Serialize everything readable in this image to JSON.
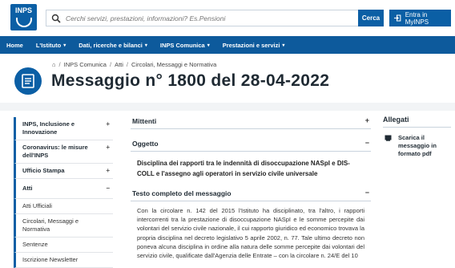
{
  "header": {
    "logo_text": "INPS",
    "search_placeholder": "Cerchi servizi, prestazioni, informazioni? Es.Pensioni",
    "search_button": "Cerca",
    "login_label": "Entra in MyINPS"
  },
  "nav": [
    "Home",
    "L'Istituto",
    "Dati, ricerche e bilanci",
    "INPS Comunica",
    "Prestazioni e servizi"
  ],
  "breadcrumb": [
    "INPS Comunica",
    "Atti",
    "Circolari, Messaggi e Normativa"
  ],
  "page_title": "Messaggio n° 1800 del 28-04-2022",
  "sidebar": {
    "items": [
      {
        "label": "INPS, Inclusione e Innovazione"
      },
      {
        "label": "Coronavirus: le misure dell'INPS"
      },
      {
        "label": "Ufficio Stampa"
      },
      {
        "label": "Atti"
      }
    ],
    "subitems": [
      "Atti Ufficiali",
      "Circolari, Messaggi e Normativa",
      "Sentenze",
      "Iscrizione Newsletter"
    ]
  },
  "sections": {
    "mittenti": "Mittenti",
    "oggetto": "Oggetto",
    "oggetto_text": "Disciplina dei rapporti tra le indennità di disoccupazione NASpI e DIS-COLL e l'assegno agli operatori in servizio civile universale",
    "testo": "Testo completo del messaggio",
    "testo_text": "Con la circolare n. 142 del 2015 l'Istituto ha disciplinato, tra l'altro, i rapporti intercorrenti tra la prestazione di disoccupazione NASpI e le somme percepite dai volontari del servizio civile nazionale, il cui rapporto giuridico ed economico trovava la propria disciplina nel decreto legislativo 5 aprile 2002, n. 77. Tale ultimo decreto non poneva alcuna disciplina in ordine alla natura delle somme percepite dai volontari del servizio civile, qualificate dall'Agenzia delle Entrate – con la circolare n. 24/E del 10"
  },
  "allegati": {
    "title": "Allegati",
    "item": "Scarica il messaggio in formato pdf"
  },
  "colors": {
    "brand": "#0b5fa5",
    "nav": "#0d5a9c"
  }
}
